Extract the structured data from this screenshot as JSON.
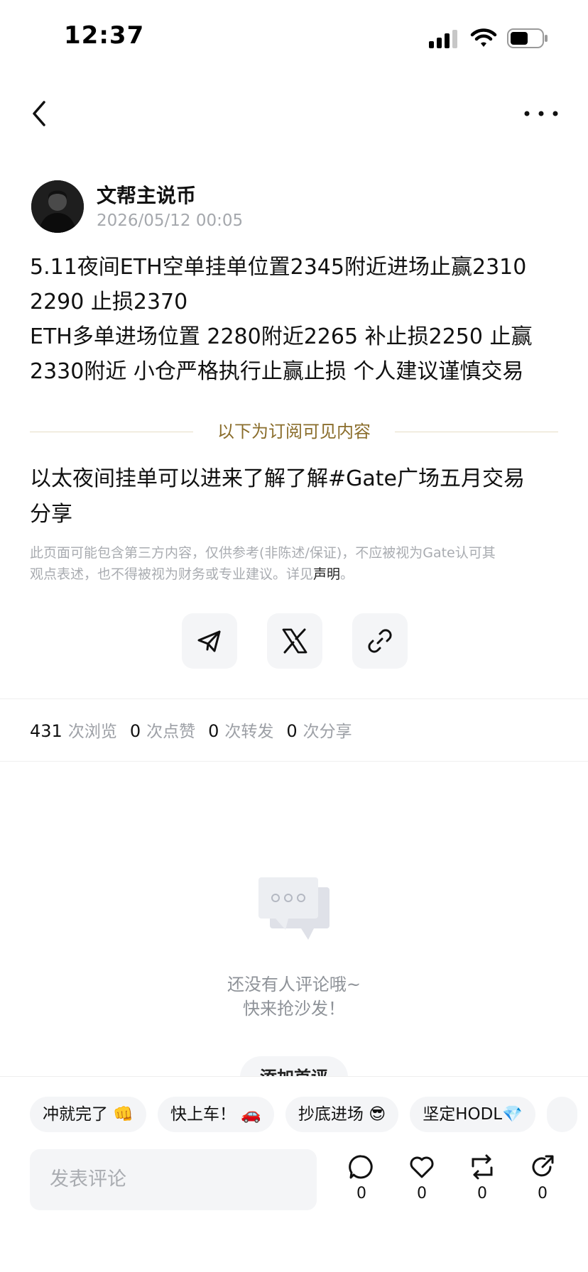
{
  "status_bar": {
    "time": "12:37"
  },
  "author": {
    "name": "文帮主说币",
    "time": "2026/05/12 00:05"
  },
  "post": {
    "lines": [
      "5.11夜间ETH空单挂单位置2345附近进场止赢2310",
      "2290 止损2370",
      "ETH多单进场位置 2280附近2265 补止损2250 止赢",
      "2330附近 小仓严格执行止赢止损 个人建议谨慎交易"
    ]
  },
  "subscriber_divider": "以下为订阅可见内容",
  "sub_content": {
    "lines": [
      "以太夜间挂单可以进来了解了解#Gate广场五月交易",
      "分享"
    ]
  },
  "disclaimer": {
    "lines": [
      "此页面可能包含第三方内容，仅供参考(非陈述/保证)，不应被视为Gate认可其",
      "观点表述，也不得被视为财务或专业建议。详见"
    ],
    "link": "声明",
    "end": "。"
  },
  "stats": [
    {
      "count": "431",
      "label": "次浏览"
    },
    {
      "count": "0",
      "label": "次点赞"
    },
    {
      "count": "0",
      "label": "次转发"
    },
    {
      "count": "0",
      "label": "次分享"
    }
  ],
  "empty_state": {
    "line1": "还没有人评论哦~",
    "line2": "快来抢沙发！"
  },
  "add_first_comment": "添加首评",
  "quick_replies": [
    "冲就完了 👊",
    "快上车！ 🚗",
    "抄底进场 😎",
    "坚定HODL💎"
  ],
  "comment_input": {
    "placeholder": "发表评论"
  },
  "actions": [
    {
      "icon": "comment-icon",
      "count": "0"
    },
    {
      "icon": "heart-icon",
      "count": "0"
    },
    {
      "icon": "repost-icon",
      "count": "0"
    },
    {
      "icon": "share-icon",
      "count": "0"
    }
  ],
  "colors": {
    "accent_gold": "#8a6d2b",
    "muted": "#9da0a6",
    "chip_bg": "#f4f5f7"
  }
}
